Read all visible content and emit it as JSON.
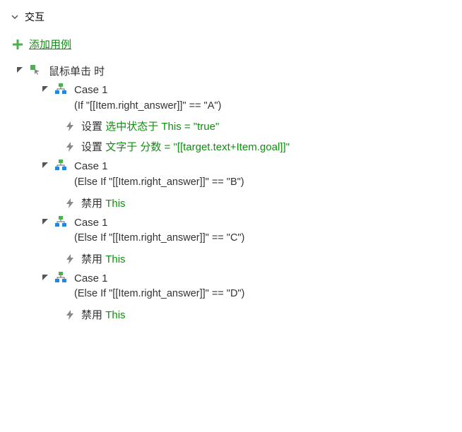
{
  "section": {
    "title": "交互"
  },
  "addCase": {
    "label": "添加用例"
  },
  "event": {
    "label": "鼠标单击 时"
  },
  "cases": [
    {
      "title": "Case 1",
      "condition": "(If \"[[Item.right_answer]]\" == \"A\")",
      "actions": [
        {
          "cmd": "设置",
          "greenPart": "选中状态于 This = \"true\""
        },
        {
          "cmd": "设置",
          "greenPart": "文字于 分数 = \"[[target.text+Item.goal]]\""
        }
      ]
    },
    {
      "title": "Case 1",
      "condition": "(Else If \"[[Item.right_answer]]\" == \"B\")",
      "actions": [
        {
          "cmd": "禁用",
          "greenPart": "This"
        }
      ]
    },
    {
      "title": "Case 1",
      "condition": "(Else If \"[[Item.right_answer]]\" == \"C\")",
      "actions": [
        {
          "cmd": "禁用",
          "greenPart": "This"
        }
      ]
    },
    {
      "title": "Case 1",
      "condition": "(Else If \"[[Item.right_answer]]\" == \"D\")",
      "actions": [
        {
          "cmd": "禁用",
          "greenPart": "This"
        }
      ]
    }
  ]
}
